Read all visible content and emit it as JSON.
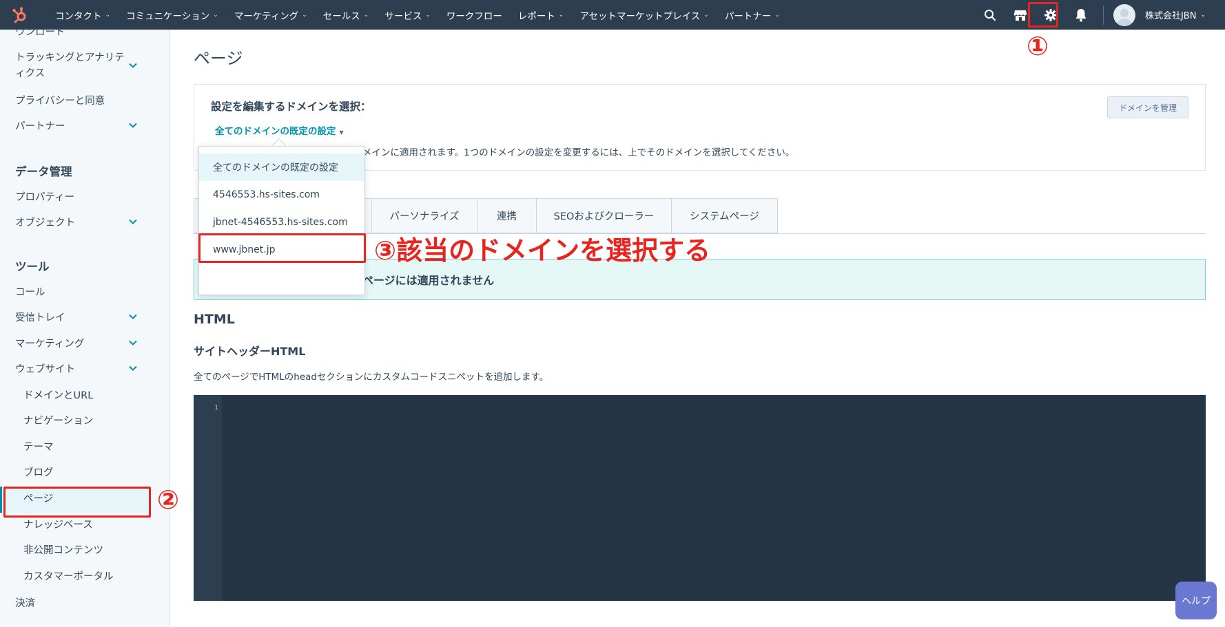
{
  "nav": {
    "items": [
      {
        "label": "コンタクト",
        "caret": true
      },
      {
        "label": "コミュニケーション",
        "caret": true
      },
      {
        "label": "マーケティング",
        "caret": true
      },
      {
        "label": "セールス",
        "caret": true
      },
      {
        "label": "サービス",
        "caret": true
      },
      {
        "label": "ワークフロー",
        "caret": false
      },
      {
        "label": "レポート",
        "caret": true
      },
      {
        "label": "アセットマーケットプレイス",
        "caret": true
      },
      {
        "label": "パートナー",
        "caret": true
      }
    ],
    "account": "株式会社JBN",
    "icons": [
      "search-icon",
      "marketplace-icon",
      "settings-icon",
      "notifications-icon"
    ]
  },
  "sidebar": {
    "items_top": {
      "download": "ウンロード",
      "tracking": "トラッキングとアナリティクス",
      "privacy": "プライバシーと同意",
      "partner": "パートナー"
    },
    "data_head": "データ管理",
    "properties": "プロパティー",
    "objects": "オブジェクト",
    "tools_head": "ツール",
    "calls": "コール",
    "inbox": "受信トレイ",
    "marketing": "マーケティング",
    "website": "ウェブサイト",
    "website_sub": {
      "domains": "ドメインとURL",
      "navigation": "ナビゲーション",
      "themes": "テーマ",
      "blog": "ブログ",
      "pages": "ページ",
      "knowledge": "ナレッジベース",
      "private": "非公開コンテンツ",
      "portal": "カスタマーポータル"
    },
    "payments": "決済"
  },
  "main": {
    "title": "ページ",
    "domain_label": "設定を編集するドメインを選択：",
    "domain_selected": "全てのドメインの既定の設定",
    "domain_info": "メインに適用されます。1つのドメインの設定を変更するには、上でそのドメインを選択してください。",
    "manage_button": "ドメインを管理",
    "tabs": [
      "",
      "グ",
      "パーソナライズ",
      "連携",
      "SEOおよびクローラー",
      "システムページ"
    ],
    "alert": "ページには適用されません",
    "section_title": "HTML",
    "sub_title": "サイトヘッダーHTML",
    "sub_desc": "全てのページでHTMLのheadセクションにカスタムコードスニペットを追加します。",
    "line_number": "1"
  },
  "dropdown": {
    "options": [
      "全てのドメインの既定の設定",
      "4546553.hs-sites.com",
      "jbnet-4546553.hs-sites.com",
      "www.jbnet.jp"
    ],
    "selected_index": 0
  },
  "annotations": {
    "step1": "①",
    "step2": "②",
    "step3": "③該当のドメインを選択する"
  },
  "help": "ヘルプ",
  "colors": {
    "nav_bg": "#2d3e50",
    "accent": "#0091ae",
    "annotation_red": "#e8241f",
    "hubspot_orange": "#ff7a59"
  }
}
